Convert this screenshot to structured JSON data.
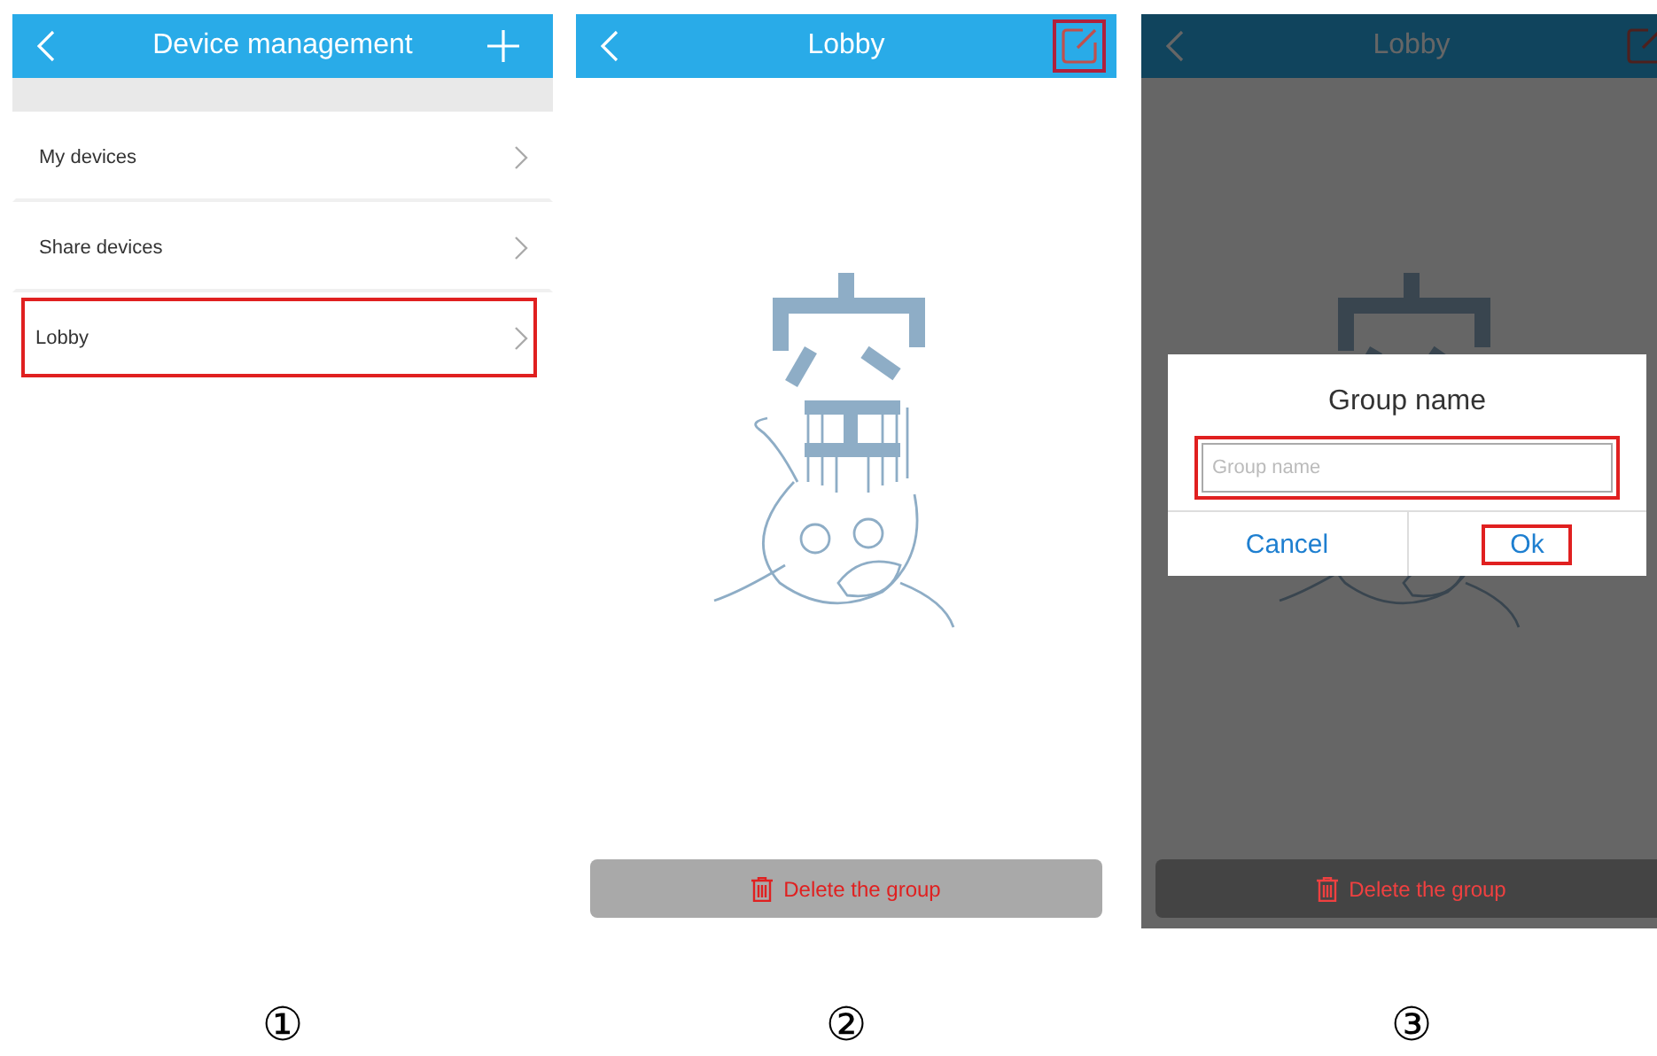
{
  "panels": [
    {
      "kind": "list",
      "title": "Device management",
      "rows": [
        {
          "label": "My devices",
          "highlighted": false
        },
        {
          "label": "Share devices",
          "highlighted": false
        },
        {
          "label": "Lobby",
          "highlighted": true
        }
      ],
      "step": "①"
    },
    {
      "kind": "empty",
      "title": "Lobby",
      "edit_highlighted": true,
      "delete_label": "Delete the group",
      "step": "②"
    },
    {
      "kind": "dialog",
      "title": "Lobby",
      "edit_highlighted": false,
      "delete_label": "Delete the group",
      "dialog": {
        "title": "Group name",
        "placeholder": "Group name",
        "field_highlighted": true,
        "buttons": [
          {
            "label": "Cancel",
            "highlighted": false
          },
          {
            "label": "Ok",
            "highlighted": true
          }
        ]
      },
      "step": "③"
    }
  ]
}
